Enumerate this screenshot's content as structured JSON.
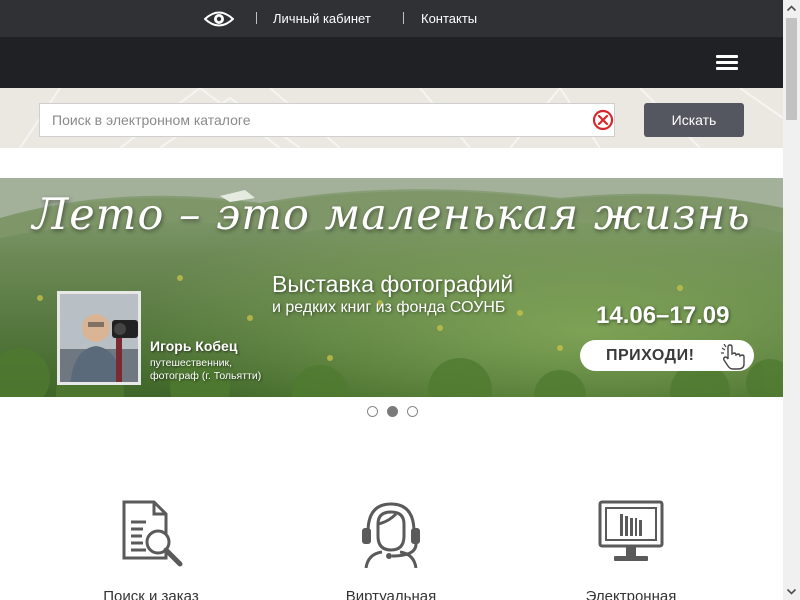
{
  "topbar": {
    "accessibility_icon": "eye-icon",
    "links": [
      "Личный кабинет",
      "Контакты"
    ]
  },
  "navbar": {
    "menu_icon": "hamburger-menu-icon"
  },
  "search": {
    "placeholder": "Поиск в электронном каталоге",
    "value": "",
    "clear_icon": "clear-x-circle-icon",
    "button_label": "Искать"
  },
  "banner": {
    "title": "Лето – это маленькая жизнь",
    "subtitle": "Выставка фотографий",
    "subtitle2": "и редких книг из фонда СОУНБ",
    "dates": "14.06–17.09",
    "cta_label": "ПРИХОДИ!",
    "cta_icon": "pointing-hand-icon",
    "person_name": "Игорь Кобец",
    "person_desc_line1": "путешественник,",
    "person_desc_line2": "фотограф (г. Тольятти)"
  },
  "slider": {
    "dot_count": 3,
    "active_index": 1
  },
  "services": [
    {
      "label": "Поиск и заказ",
      "icon": "document-search-icon"
    },
    {
      "label": "Виртуальная",
      "icon": "headset-operator-icon"
    },
    {
      "label": "Электронная",
      "icon": "monitor-library-icon"
    }
  ],
  "colors": {
    "topbar": "#2f3135",
    "navbar": "#202124",
    "search_band": "#ebe8e2",
    "search_button": "#54575f",
    "clear_icon": "#d9262c"
  }
}
